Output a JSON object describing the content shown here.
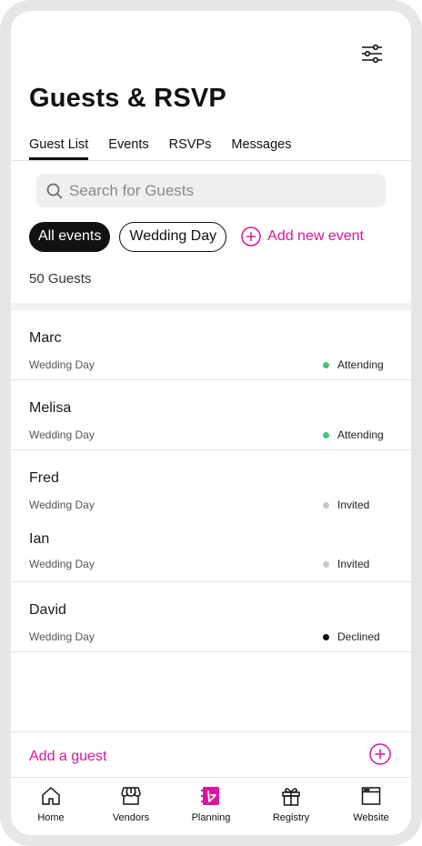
{
  "header": {
    "title": "Guests & RSVP",
    "filter_icon": "sliders-icon"
  },
  "tabs": [
    {
      "label": "Guest List",
      "active": true
    },
    {
      "label": "Events",
      "active": false
    },
    {
      "label": "RSVPs",
      "active": false
    },
    {
      "label": "Messages",
      "active": false
    }
  ],
  "search": {
    "placeholder": "Search for Guests",
    "value": ""
  },
  "event_filters": [
    {
      "label": "All events",
      "selected": true
    },
    {
      "label": "Wedding Day",
      "selected": false
    }
  ],
  "add_event_label": "Add new event",
  "guest_count": "50 Guests",
  "guest_groups": [
    [
      {
        "name": "Marc",
        "event": "Wedding Day",
        "status": "Attending"
      }
    ],
    [
      {
        "name": "Melisa",
        "event": "Wedding Day",
        "status": "Attending"
      }
    ],
    [
      {
        "name": "Fred",
        "event": "Wedding Day",
        "status": "Invited"
      },
      {
        "name": "Ian",
        "event": "Wedding Day",
        "status": "Invited"
      }
    ],
    [
      {
        "name": "David",
        "event": "Wedding Day",
        "status": "Declined"
      }
    ]
  ],
  "status_colors": {
    "Attending": "#4fbf7f",
    "Invited": "#c9c9c9",
    "Declined": "#111111"
  },
  "add_guest_label": "Add a guest",
  "accent_color": "#d6179e",
  "bottom_nav": [
    {
      "label": "Home",
      "icon": "home-icon",
      "active": false
    },
    {
      "label": "Vendors",
      "icon": "storefront-icon",
      "active": false
    },
    {
      "label": "Planning",
      "icon": "planning-icon",
      "active": true
    },
    {
      "label": "Registry",
      "icon": "gift-icon",
      "active": false
    },
    {
      "label": "Website",
      "icon": "browser-window-icon",
      "active": false
    }
  ]
}
